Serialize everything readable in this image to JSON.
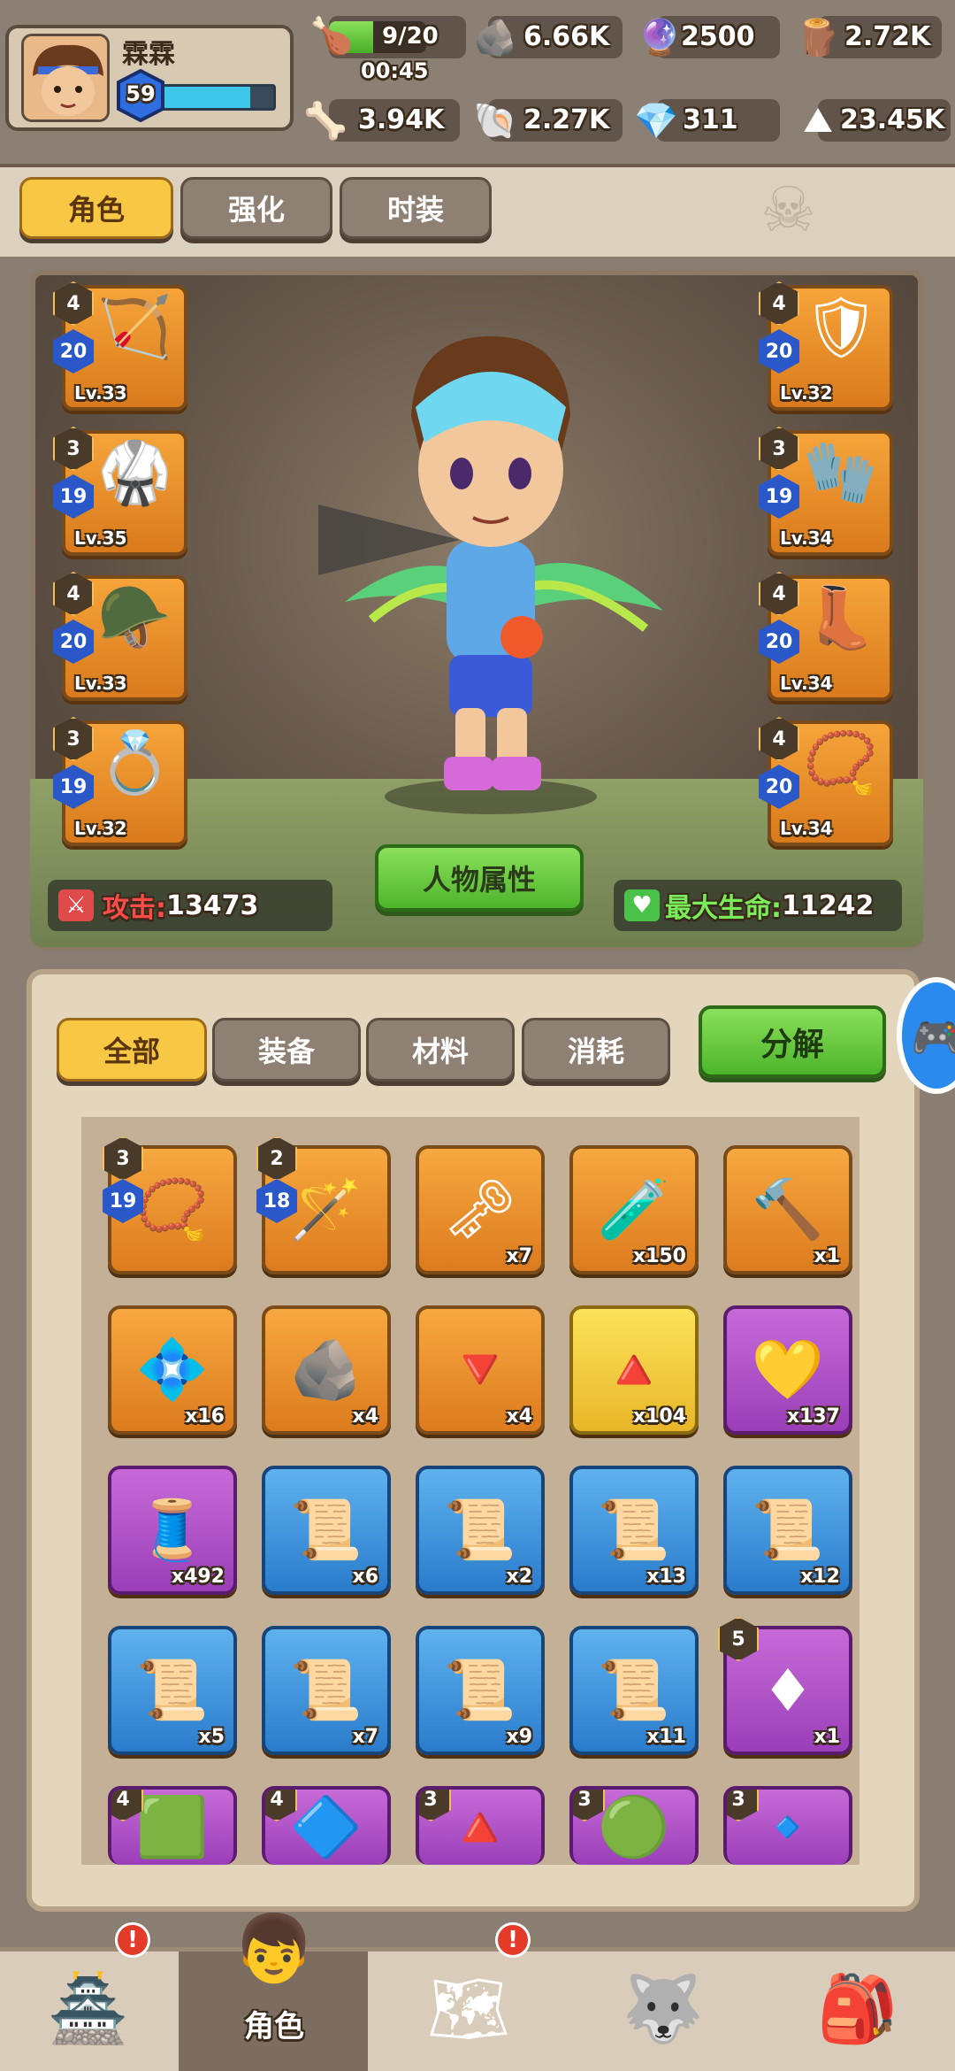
{
  "player": {
    "name": "霖霖",
    "level": "59",
    "exp_fraction": 0.8
  },
  "resources": {
    "stamina": {
      "value": "9/20",
      "timer": "00:45",
      "fraction": 0.45
    },
    "stone": "6.66K",
    "orb": "2500",
    "wood": "2.72K",
    "bone": "3.94K",
    "shell": "2.27K",
    "gem": "311",
    "ore": "23.45K"
  },
  "top_tabs": [
    "角色",
    "强化",
    "时装"
  ],
  "equipment_left": [
    {
      "tier": "4",
      "num": "20",
      "level": "Lv.33",
      "icon": "bow-icon"
    },
    {
      "tier": "3",
      "num": "19",
      "level": "Lv.35",
      "icon": "armor-icon"
    },
    {
      "tier": "4",
      "num": "20",
      "level": "Lv.33",
      "icon": "helmet-icon"
    },
    {
      "tier": "3",
      "num": "19",
      "level": "Lv.32",
      "icon": "ring-icon"
    }
  ],
  "equipment_right": [
    {
      "tier": "4",
      "num": "20",
      "level": "Lv.32",
      "icon": "shield-icon"
    },
    {
      "tier": "3",
      "num": "19",
      "level": "Lv.34",
      "icon": "glove-icon"
    },
    {
      "tier": "4",
      "num": "20",
      "level": "Lv.34",
      "icon": "boots-icon"
    },
    {
      "tier": "4",
      "num": "20",
      "level": "Lv.34",
      "icon": "necklace-icon"
    }
  ],
  "stats": {
    "attack_label": "攻击:",
    "attack_value": "13473",
    "hp_label": "最大生命:",
    "hp_value": "11242",
    "attr_button": "人物属性"
  },
  "inventory": {
    "filters": [
      "全部",
      "装备",
      "材料",
      "消耗"
    ],
    "decompose": "分解",
    "items": [
      {
        "style": "orange",
        "icon": "necklace-icon",
        "tier": "3",
        "num": "19",
        "count": ""
      },
      {
        "style": "orange",
        "icon": "staff-icon",
        "tier": "2",
        "num": "18",
        "count": ""
      },
      {
        "style": "orange",
        "icon": "key-icon",
        "count": "x7"
      },
      {
        "style": "orange",
        "icon": "potion-icon",
        "count": "x150"
      },
      {
        "style": "orange",
        "icon": "hammer-icon",
        "count": "x1"
      },
      {
        "style": "orange",
        "icon": "crystal-icon",
        "count": "x16"
      },
      {
        "style": "orange",
        "icon": "rune-stone-icon",
        "count": "x4"
      },
      {
        "style": "orange",
        "icon": "red-crystal-icon",
        "count": "x4"
      },
      {
        "style": "gold",
        "icon": "pyramid-icon",
        "count": "x104"
      },
      {
        "style": "purple",
        "icon": "heart-gem-icon",
        "count": "x137"
      },
      {
        "style": "purple",
        "icon": "cloth-icon",
        "count": "x492"
      },
      {
        "style": "blue",
        "icon": "scroll-icon",
        "count": "x6"
      },
      {
        "style": "blue",
        "icon": "scroll-icon",
        "count": "x2"
      },
      {
        "style": "blue",
        "icon": "scroll-icon",
        "count": "x13"
      },
      {
        "style": "blue",
        "icon": "scroll-icon",
        "count": "x12"
      },
      {
        "style": "blue",
        "icon": "scroll-icon",
        "count": "x5"
      },
      {
        "style": "blue",
        "icon": "scroll-icon",
        "count": "x7"
      },
      {
        "style": "blue",
        "icon": "scroll-icon",
        "count": "x9"
      },
      {
        "style": "blue",
        "icon": "scroll-icon",
        "count": "x11"
      },
      {
        "style": "purple",
        "icon": "ruby-icon",
        "tier": "5",
        "count": "x1"
      },
      {
        "style": "purple",
        "icon": "emerald-icon",
        "tier": "4",
        "count": ""
      },
      {
        "style": "purple",
        "icon": "sapphire-icon",
        "tier": "4",
        "count": ""
      },
      {
        "style": "purple",
        "icon": "red-triangle-gem-icon",
        "tier": "3",
        "count": ""
      },
      {
        "style": "purple",
        "icon": "green-triangle-gem-icon",
        "tier": "3",
        "count": ""
      },
      {
        "style": "purple",
        "icon": "blue-triangle-gem-icon",
        "tier": "3",
        "count": ""
      }
    ]
  },
  "bottom_nav": {
    "role_label": "角色",
    "badge": "!"
  }
}
